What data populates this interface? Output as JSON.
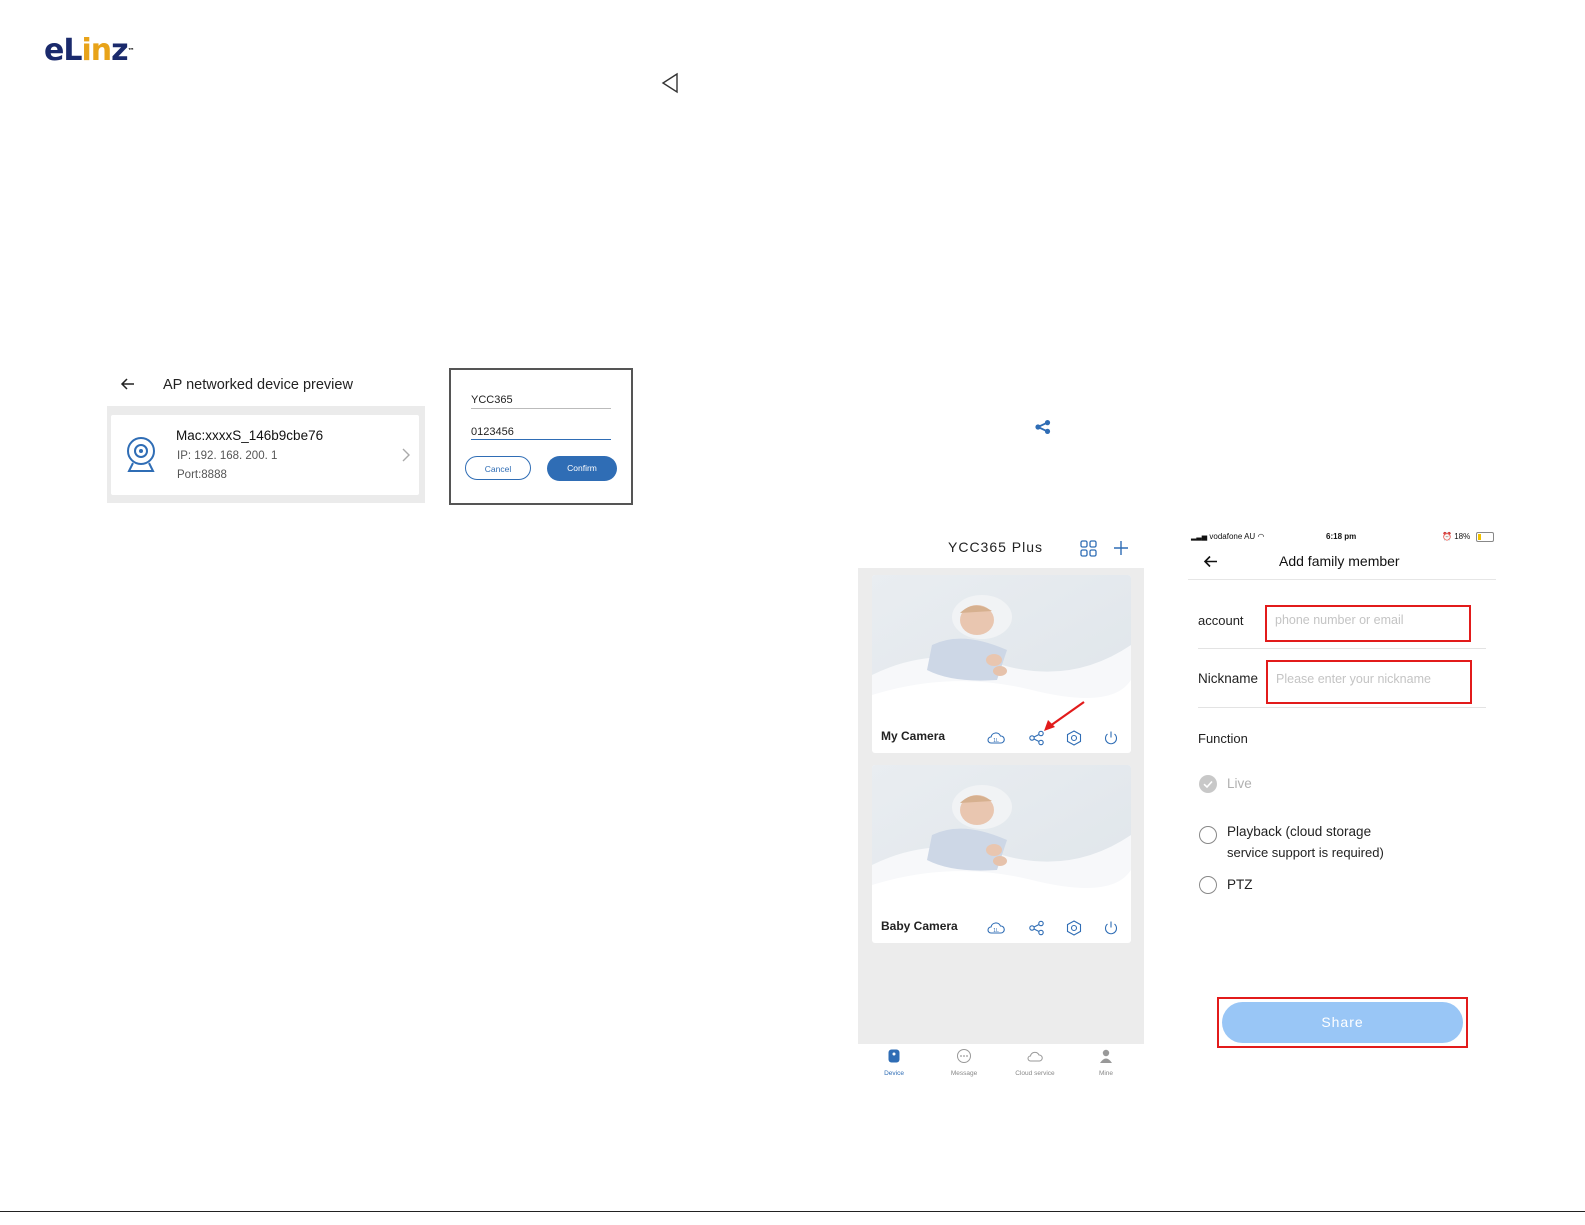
{
  "brand": {
    "logo_text": "eLinz",
    "trademark": "™"
  },
  "ap_preview": {
    "title": "AP networked device preview",
    "device": {
      "mac": "Mac:xxxxS_146b9cbe76",
      "ip": "IP: 192. 168. 200. 1",
      "port": "Port:8888"
    }
  },
  "login_dialog": {
    "username": "YCC365",
    "password": "0123456",
    "cancel_label": "Cancel",
    "confirm_label": "Confirm",
    "accent_color": "#2f6db5"
  },
  "device_list": {
    "title": "YCC365 Plus",
    "cameras": [
      {
        "name": "My Camera",
        "cloud_label": "1L"
      },
      {
        "name": "Baby Camera",
        "cloud_label": "1L"
      }
    ],
    "tabs": [
      {
        "label": "Device",
        "icon": "device-icon",
        "active": true
      },
      {
        "label": "Message",
        "icon": "message-icon",
        "active": false
      },
      {
        "label": "Cloud service",
        "icon": "cloud-icon",
        "active": false
      },
      {
        "label": "Mine",
        "icon": "person-icon",
        "active": false
      }
    ],
    "active_color": "#2f6db5"
  },
  "status_bar": {
    "carrier": "vodafone AU",
    "time": "6:18 pm",
    "battery": "18%"
  },
  "add_family": {
    "title": "Add family member",
    "account_label": "account",
    "account_placeholder": "phone number or email",
    "nickname_label": "Nickname",
    "nickname_placeholder": "Please enter your nickname",
    "function_label": "Function",
    "options": [
      {
        "label": "Live",
        "checked": true
      },
      {
        "label_line1": "Playback (cloud storage",
        "label_line2": "service support is required)",
        "checked": false
      },
      {
        "label": "PTZ",
        "checked": false
      }
    ],
    "share_label": "Share",
    "highlight_color": "#e21b1b",
    "share_color": "#99c6f6"
  }
}
